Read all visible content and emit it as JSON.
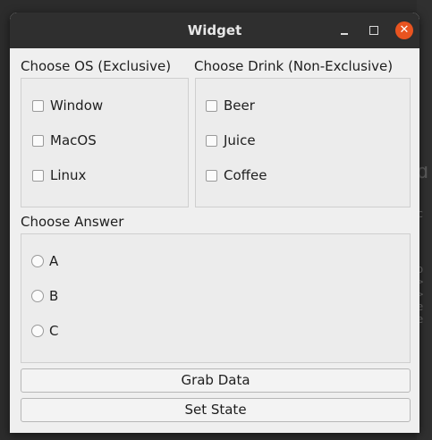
{
  "window": {
    "title": "Widget"
  },
  "os_group": {
    "title": "Choose OS (Exclusive)",
    "options": [
      {
        "label": "Window",
        "checked": false
      },
      {
        "label": "MacOS",
        "checked": false
      },
      {
        "label": "Linux",
        "checked": false
      }
    ]
  },
  "drink_group": {
    "title": "Choose Drink (Non-Exclusive)",
    "options": [
      {
        "label": "Beer",
        "checked": false
      },
      {
        "label": "Juice",
        "checked": false
      },
      {
        "label": "Coffee",
        "checked": false
      }
    ]
  },
  "answer_group": {
    "title": "Choose Answer",
    "options": [
      {
        "label": "A",
        "selected": false
      },
      {
        "label": "B",
        "selected": false
      },
      {
        "label": "C",
        "selected": false
      }
    ]
  },
  "buttons": {
    "grab": "Grab Data",
    "set_state": "Set State"
  },
  "colors": {
    "close_button": "#e95420",
    "titlebar": "#2f2f2f",
    "window_bg": "#efefef"
  }
}
